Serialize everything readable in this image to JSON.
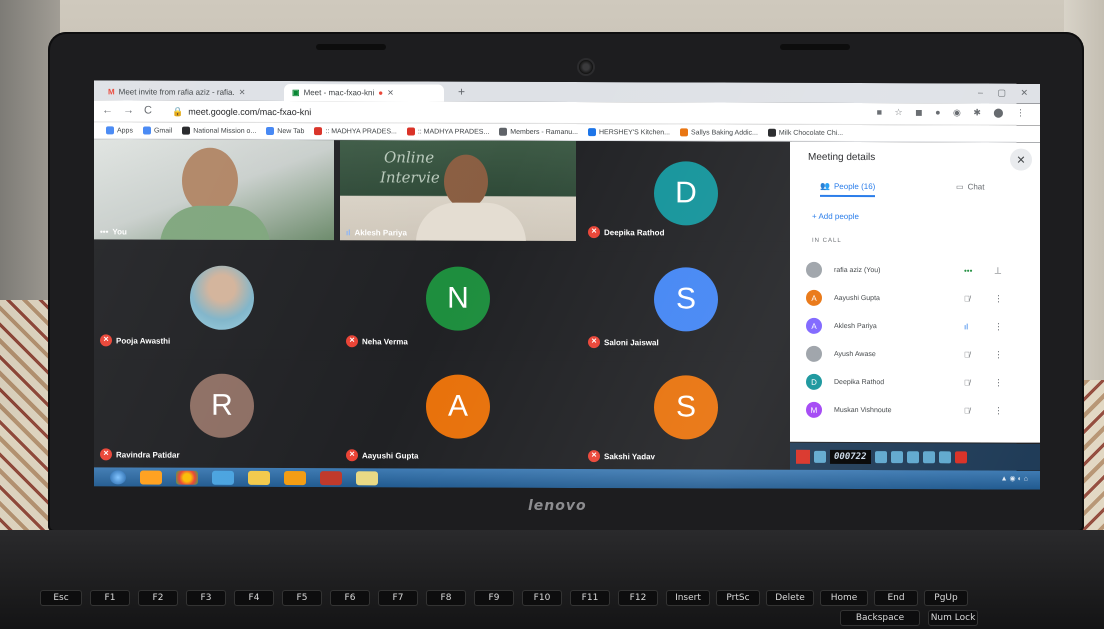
{
  "browser": {
    "tabs": [
      {
        "label": "Meet invite from rafia aziz - rafia.",
        "close": "✕"
      },
      {
        "label": "Meet - mac-fxao-kni",
        "close": "✕"
      }
    ],
    "new_tab": "+",
    "url": "meet.google.com/mac-fxao-kni",
    "bookmarks": [
      {
        "label": "Apps",
        "color": "#4285f4"
      },
      {
        "label": "Gmail",
        "color": "#ea4335"
      },
      {
        "label": "National Mission o...",
        "color": "#202124"
      },
      {
        "label": "New Tab",
        "color": "#4285f4"
      },
      {
        "label": ":: MADHYA PRADES...",
        "color": "#d93025"
      },
      {
        "label": ":: MADHYA PRADES...",
        "color": "#d93025"
      },
      {
        "label": "Members - Ramanu...",
        "color": "#5f6368"
      },
      {
        "label": "HERSHEY'S Kitchen...",
        "color": "#1a73e8"
      },
      {
        "label": "Sallys Baking Addic...",
        "color": "#e8710a"
      },
      {
        "label": "Milk Chocolate Chi...",
        "color": "#202124"
      }
    ]
  },
  "meet": {
    "self_label": "You",
    "presenter_name": "Aklesh Pariya",
    "board_text_1": "Online",
    "board_text_2": "Intervie",
    "participants": [
      {
        "name": "Deepika Rathod",
        "initial": "D",
        "color": "#12939a"
      },
      {
        "name": "Pooja Awasthi",
        "initial": "",
        "color": "#8ab4f8"
      },
      {
        "name": "Neha Verma",
        "initial": "N",
        "color": "#1e8e3e"
      },
      {
        "name": "Saloni Jaiswal",
        "initial": "S",
        "color": "#4285f4"
      },
      {
        "name": "Ravindra Patidar",
        "initial": "R",
        "color": "#8d6e63"
      },
      {
        "name": "Aayushi Gupta",
        "initial": "A",
        "color": "#e8710a"
      },
      {
        "name": "Sakshi Yadav",
        "initial": "S",
        "color": "#e8710a"
      }
    ]
  },
  "panel": {
    "title": "Meeting details",
    "people_tab": "People (16)",
    "chat_tab": "Chat",
    "add_people": "Add people",
    "in_call": "IN CALL",
    "people": [
      {
        "name": "rafia aziz (You)",
        "initial": "",
        "color": "#9aa0a6",
        "mic": "•••"
      },
      {
        "name": "Aayushi Gupta",
        "initial": "A",
        "color": "#e8710a",
        "mic": "🎙̸"
      },
      {
        "name": "Aklesh Pariya",
        "initial": "A",
        "color": "#7b61ff",
        "mic": "ıl"
      },
      {
        "name": "Ayush Awase",
        "initial": "",
        "color": "#9aa0a6",
        "mic": "🎙̸"
      },
      {
        "name": "Deepika Rathod",
        "initial": "D",
        "color": "#12939a",
        "mic": "🎙̸"
      },
      {
        "name": "Muskan Vishnoute",
        "initial": "M",
        "color": "#a142f4",
        "mic": "🎙̸"
      }
    ]
  },
  "recorder": {
    "timer": "000722"
  },
  "laptop": {
    "brand": "lenovo"
  },
  "keys": [
    "Esc",
    "F1",
    "F2",
    "F3",
    "F4",
    "F5",
    "F6",
    "F7",
    "F8",
    "F9",
    "F10",
    "F11",
    "F12",
    "Insert",
    "PrtSc",
    "Delete",
    "Home",
    "End",
    "PgUp"
  ],
  "keys_row2": [
    "Backspace",
    "Num Lock"
  ]
}
